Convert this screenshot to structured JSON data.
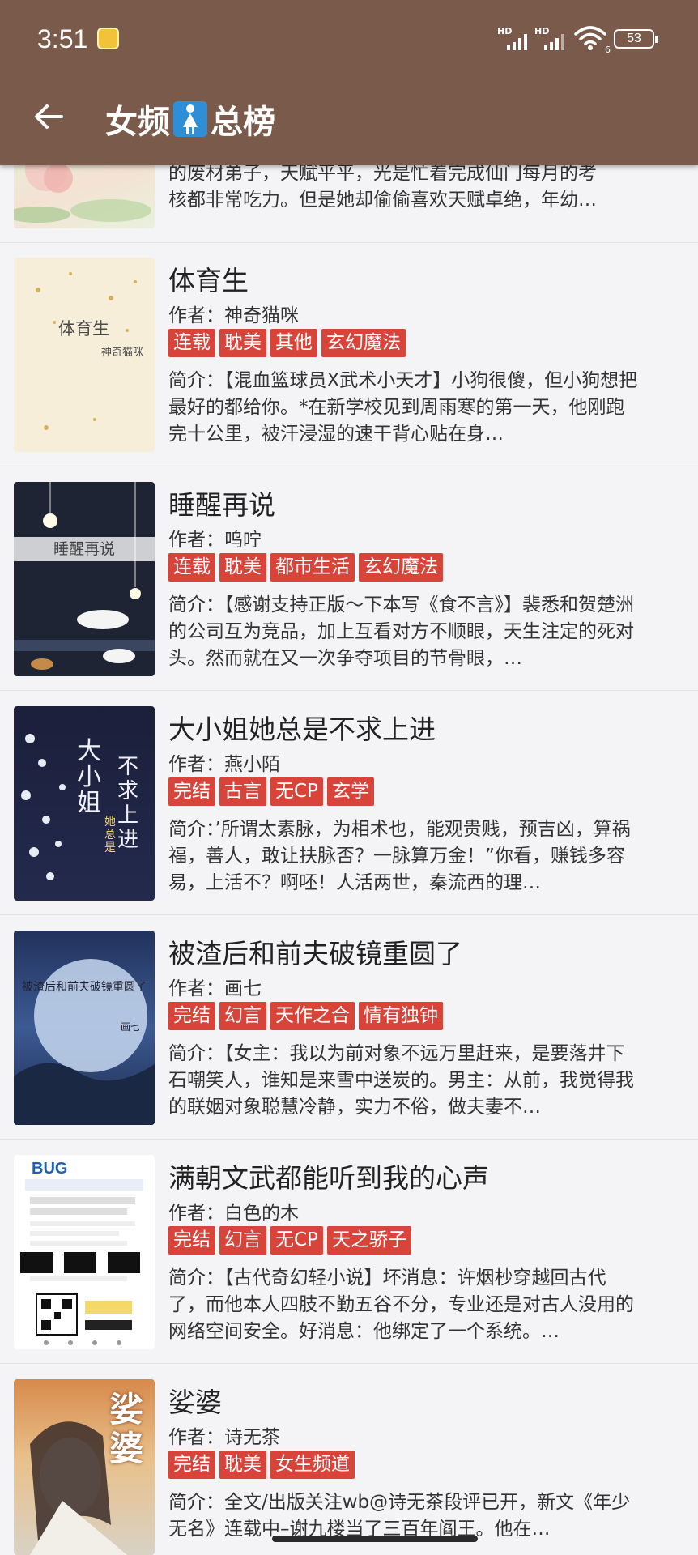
{
  "status_bar": {
    "time": "3:51",
    "sim1": "HD",
    "sim2": "HD",
    "wifi_sub": "6",
    "battery": "53"
  },
  "header": {
    "back_icon": "arrow-left-icon",
    "title_part1": "女频",
    "title_icon": "womens-restroom-icon",
    "title_part2": "总榜"
  },
  "colors": {
    "appbar": "#7a5b4b",
    "tag": "#d9443a",
    "background": "#f4f4f6"
  },
  "top_partial": {
    "desc_line1": "的废材弟子，天赋平平，光是忙着完成仙门每月的考",
    "desc_line2": "核都非常吃力。但是她却偷偷喜欢天赋卓绝，年幼…"
  },
  "books": [
    {
      "title": "体育生",
      "author": "作者：神奇猫咪",
      "tags": [
        "连载",
        "耽美",
        "其他",
        "玄幻魔法"
      ],
      "desc": "简介：【混血篮球员X武术小天才】小狗很傻，但小狗想把最好的都给你。*在新学校见到周雨寒的第一天，他刚跑完十公里，被汗浸湿的速干背心贴在身…",
      "cover_title": "体育生",
      "cover_author": "神奇猫咪"
    },
    {
      "title": "睡醒再说",
      "author": "作者：呜咛",
      "tags": [
        "连载",
        "耽美",
        "都市生活",
        "玄幻魔法"
      ],
      "desc": "简介：【感谢支持正版～下本写《食不言》】裴悉和贺楚洲的公司互为竞品，加上互看对方不顺眼，天生注定的死对头。然而就在又一次争夺项目的节骨眼，…",
      "cover_title": "睡醒再说"
    },
    {
      "title": "大小姐她总是不求上进",
      "author": "作者：燕小陌",
      "tags": [
        "完结",
        "古言",
        "无CP",
        "玄学"
      ],
      "desc": "简介：’所谓太素脉，为相术也，能观贵贱，预吉凶，算祸福，善人，敢让扶脉否？一脉算万金！”你看，赚钱多容易，上活不？啊呸！人活两世，秦流西的理…",
      "cover_title_a": "大小姐",
      "cover_title_b": "不求上进",
      "cover_title_c": "她总是"
    },
    {
      "title": "被渣后和前夫破镜重圆了",
      "author": "作者：画七",
      "tags": [
        "完结",
        "幻言",
        "天作之合",
        "情有独钟"
      ],
      "desc": "简介：【女主：我以为前对象不远万里赶来，是要落井下石嘲笑人，谁知是来雪中送炭的。男主：从前，我觉得我的联姻对象聪慧冷静，实力不俗，做夫妻不…",
      "cover_title": "被渣后和前夫破镜重圆了",
      "cover_author": "画七"
    },
    {
      "title": "满朝文武都能听到我的心声",
      "author": "作者：白色的木",
      "tags": [
        "完结",
        "幻言",
        "无CP",
        "天之骄子"
      ],
      "desc": "简介：【古代奇幻轻小说】坏消息：许烟杪穿越回古代了，而他本人四肢不勤五谷不分，专业还是对古人没用的网络空间安全。好消息：他绑定了一个系统。…",
      "cover_title": "BUG"
    },
    {
      "title": "娑婆",
      "author": "作者：诗无茶",
      "tags": [
        "完结",
        "耽美",
        "女生频道"
      ],
      "desc": "简介：全文/出版关注wb@诗无茶段评已开，新文《年少无名》连载中–谢九楼当了三百年阎王。他在…",
      "cover_title": "娑婆"
    }
  ]
}
